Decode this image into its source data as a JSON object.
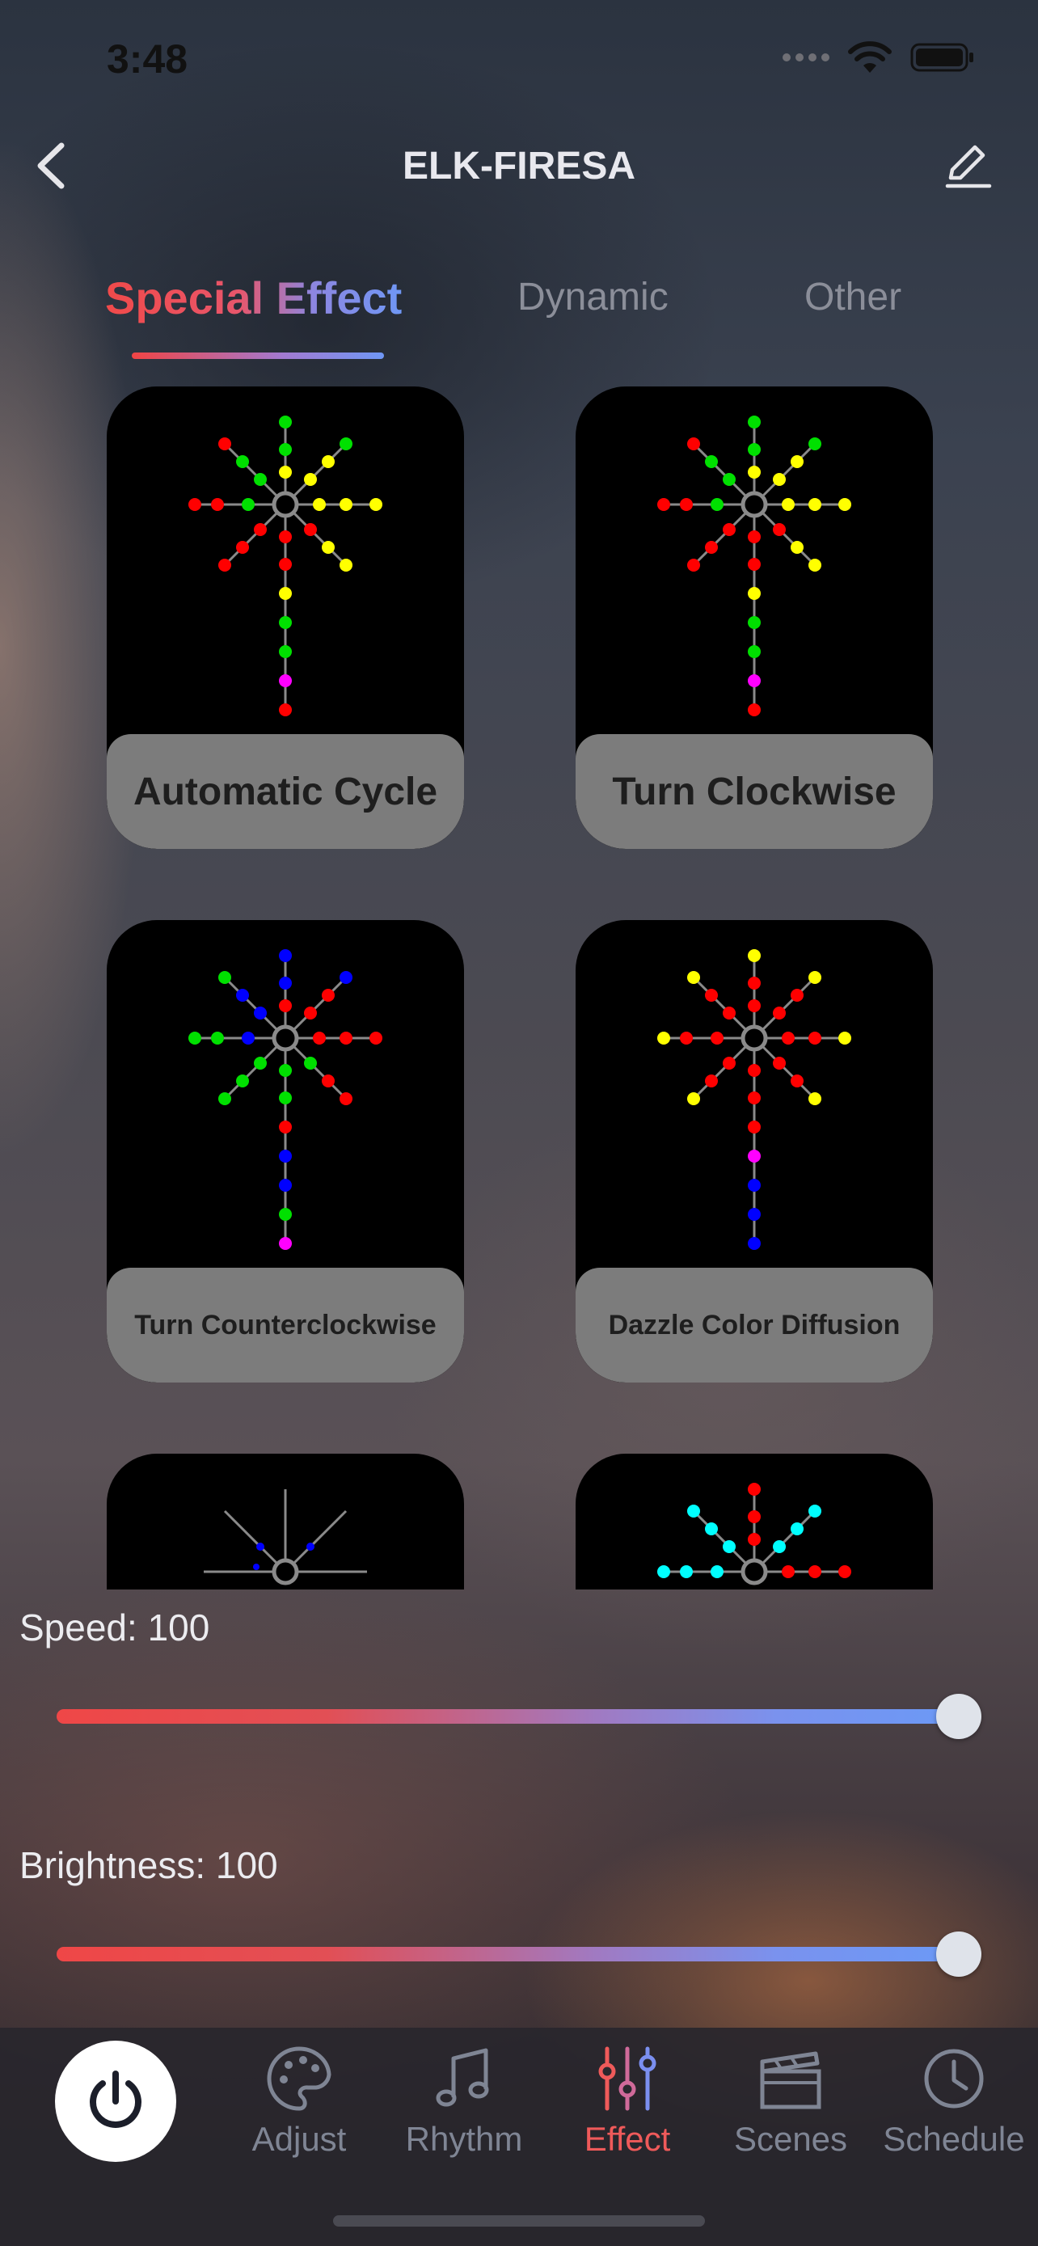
{
  "status_bar": {
    "time": "3:48"
  },
  "header": {
    "title": "ELK-FIRESA",
    "back_icon": "chevron-left-icon",
    "edit_icon": "pencil-icon"
  },
  "tabs": [
    {
      "label": "Special Effect",
      "active": true
    },
    {
      "label": "Dynamic",
      "active": false
    },
    {
      "label": "Other",
      "active": false
    }
  ],
  "effects": [
    {
      "label": "Automatic Cycle",
      "palette": [
        "#ff0000",
        "#00ff00",
        "#ffff00"
      ]
    },
    {
      "label": "Turn Clockwise",
      "palette": [
        "#ff0000",
        "#00ff00",
        "#ffff00"
      ]
    },
    {
      "label": "Turn Counterclockwise",
      "palette": [
        "#0000ff",
        "#00ff00",
        "#ff0000"
      ]
    },
    {
      "label": "Dazzle Color Diffusion",
      "palette": [
        "#ff0000",
        "#ffff00"
      ]
    }
  ],
  "sliders": {
    "speed": {
      "label": "Speed: 100",
      "value": 100
    },
    "brightness": {
      "label": "Brightness: 100",
      "value": 100
    }
  },
  "bottom_nav": [
    {
      "label": "Adjust",
      "icon": "palette-icon",
      "active": false
    },
    {
      "label": "Rhythm",
      "icon": "music-note-icon",
      "active": false
    },
    {
      "label": "Effect",
      "icon": "sliders-icon",
      "active": true
    },
    {
      "label": "Scenes",
      "icon": "clapperboard-icon",
      "active": false
    },
    {
      "label": "Schedule",
      "icon": "clock-icon",
      "active": false
    }
  ],
  "colors": {
    "accent_red": "#ef4747",
    "accent_blue": "#6b99f6",
    "active_nav": "#ef5a5a"
  }
}
